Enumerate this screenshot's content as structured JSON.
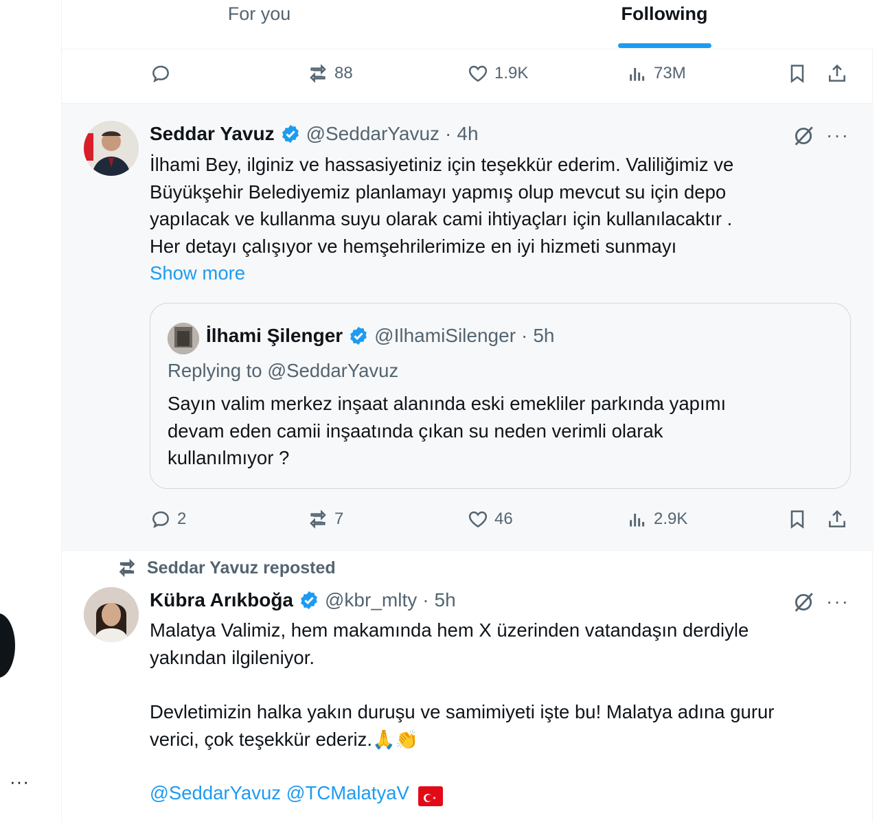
{
  "tabs": [
    {
      "label": "For you",
      "active": false
    },
    {
      "label": "Following",
      "active": true
    }
  ],
  "colors": {
    "accent": "#1d9bf0",
    "text": "#0f1419",
    "secondary": "#536471",
    "highlight_bg": "#f7f8f9",
    "flag_red": "#e30a17"
  },
  "top_actions": {
    "reply": "",
    "repost": "88",
    "like": "1.9K",
    "views": "73M"
  },
  "tweet1": {
    "name": "Seddar Yavuz",
    "handle": "@SeddarYavuz",
    "sep": "·",
    "time": "4h",
    "text_lines": [
      "İlhami Bey, ilginiz ve hassasiyetiniz için teşekkür ederim. Valiliğimiz ve",
      "Büyükşehir Belediyemiz planlamayı yapmış olup mevcut su için depo",
      "yapılacak ve kullanma suyu olarak cami ihtiyaçları için kullanılacaktır .",
      "Her detayı çalışıyor ve hemşehrilerimize en iyi hizmeti sunmayı"
    ],
    "show_more": "Show more",
    "quote": {
      "name": "İlhami Şilenger",
      "handle": "@IlhamiSilenger",
      "sep": "·",
      "time": "5h",
      "replying": "Replying to @SeddarYavuz",
      "text_lines": [
        "Sayın valim merkez inşaat alanında eski emekliler parkında yapımı",
        "devam eden camii inşaatında çıkan su neden verimli olarak",
        "kullanılmıyor ?"
      ]
    },
    "actions": {
      "reply": "2",
      "repost": "7",
      "like": "46",
      "views": "2.9K"
    }
  },
  "tweet2": {
    "repost_label": "Seddar Yavuz reposted",
    "name": "Kübra Arıkboğa",
    "handle": "@kbr_mlty",
    "sep": "·",
    "time": "5h",
    "text_lines": [
      "Malatya Valimiz, hem makamında hem X üzerinden vatandaşın derdiyle",
      "yakından ilgileniyor."
    ],
    "text2_lines": [
      "Devletimizin halka yakın duruşu ve samimiyeti işte bu! Malatya adına gurur",
      "verici, çok teşekkür ederiz."
    ],
    "emoji": "🙏👏",
    "mention1": "@SeddarYavuz",
    "mention2": "@TCMalatyaV"
  },
  "left_rail": {
    "more": "···"
  }
}
